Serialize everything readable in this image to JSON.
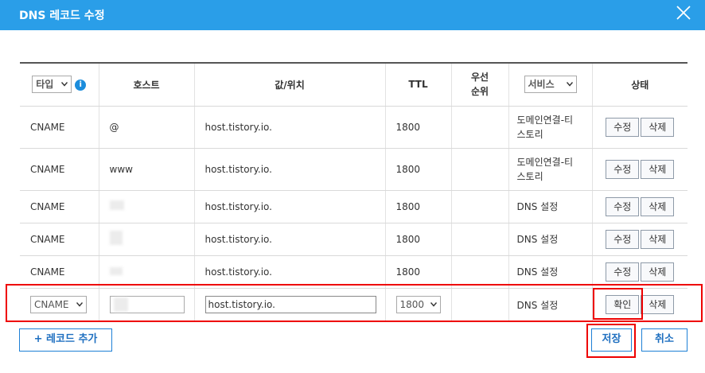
{
  "dialog": {
    "title": "DNS 레코드 수정"
  },
  "header": {
    "type_select": "타입",
    "host": "호스트",
    "value": "값/위치",
    "ttl": "TTL",
    "priority": "우선\n순위",
    "service_select": "서비스",
    "status": "상태"
  },
  "rows": [
    {
      "type": "CNAME",
      "host": "@",
      "value": "host.tistory.io.",
      "ttl": "1800",
      "service": "도메인연결-티\n스토리",
      "edit": "수정",
      "delete": "삭제"
    },
    {
      "type": "CNAME",
      "host": "www",
      "value": "host.tistory.io.",
      "ttl": "1800",
      "service": "도메인연결-티\n스토리",
      "edit": "수정",
      "delete": "삭제"
    },
    {
      "type": "CNAME",
      "host": "",
      "value": "host.tistory.io.",
      "ttl": "1800",
      "service": "DNS 설정",
      "edit": "수정",
      "delete": "삭제"
    },
    {
      "type": "CNAME",
      "host": "",
      "value": "host.tistory.io.",
      "ttl": "1800",
      "service": "DNS 설정",
      "edit": "수정",
      "delete": "삭제"
    },
    {
      "type": "CNAME",
      "host": "",
      "value": "host.tistory.io.",
      "ttl": "1800",
      "service": "DNS 설정",
      "edit": "수정",
      "delete": "삭제"
    }
  ],
  "edit_row": {
    "type": "CNAME",
    "host": "",
    "value": "host.tistory.io.",
    "ttl": "1800",
    "service": "DNS 설정",
    "confirm": "확인",
    "delete": "삭제"
  },
  "footer": {
    "add_record": "+ 레코드 추가",
    "save": "저장",
    "cancel": "취소"
  },
  "colors": {
    "titlebar": "#2a9ee8",
    "accent": "#1e80d6",
    "highlight": "#e00000"
  }
}
